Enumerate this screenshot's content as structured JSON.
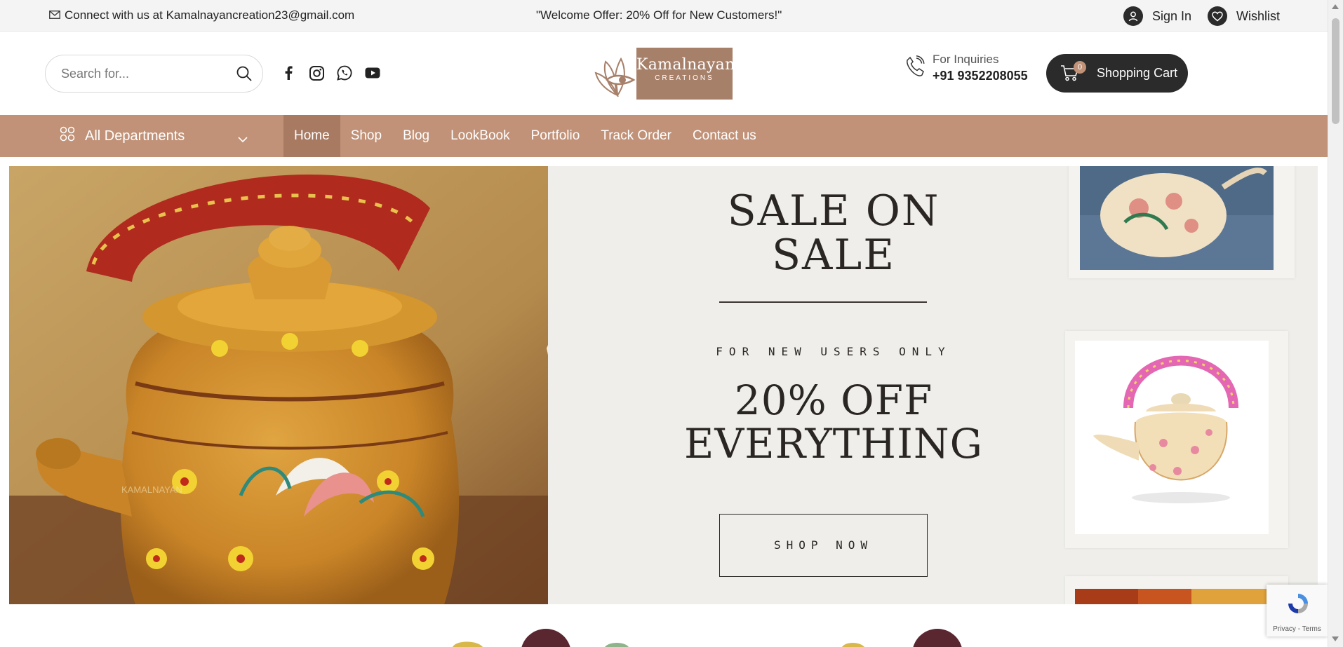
{
  "topbar": {
    "contact_text": "Connect with us at Kamalnayancreation23@gmail.com",
    "offer_text": "\"Welcome Offer: 20% Off for New Customers!\"",
    "signin_label": "Sign In",
    "wishlist_label": "Wishlist"
  },
  "header": {
    "search_placeholder": "Search for...",
    "social": [
      "facebook-icon",
      "instagram-icon",
      "whatsapp-icon",
      "youtube-icon"
    ],
    "logo_name": "Kamalnayan",
    "logo_sub": "CREATIONS",
    "inquiries_label": "For Inquiries",
    "phone": "+91 9352208055",
    "cart_count": "0",
    "cart_label": "Shopping Cart"
  },
  "nav": {
    "departments_label": "All Departments",
    "items": [
      {
        "label": "Home",
        "active": true
      },
      {
        "label": "Shop"
      },
      {
        "label": "Blog"
      },
      {
        "label": "LookBook"
      },
      {
        "label": "Portfolio"
      },
      {
        "label": "Track Order"
      },
      {
        "label": "Contact us"
      }
    ]
  },
  "hero": {
    "title_line1": "SALE ON",
    "title_line2": "SALE",
    "subtitle": "FOR NEW USERS ONLY",
    "offer_line1": "20% OFF",
    "offer_line2": "EVERYTHING",
    "cta": "SHOP NOW",
    "watermark": "KAMALNAYAN"
  },
  "recaptcha": {
    "terms": "Privacy - Terms"
  },
  "colors": {
    "brand": "#c19277",
    "brand_dark": "#a87a61",
    "dark": "#2b2b2b",
    "logo_box": "#a7806a"
  }
}
